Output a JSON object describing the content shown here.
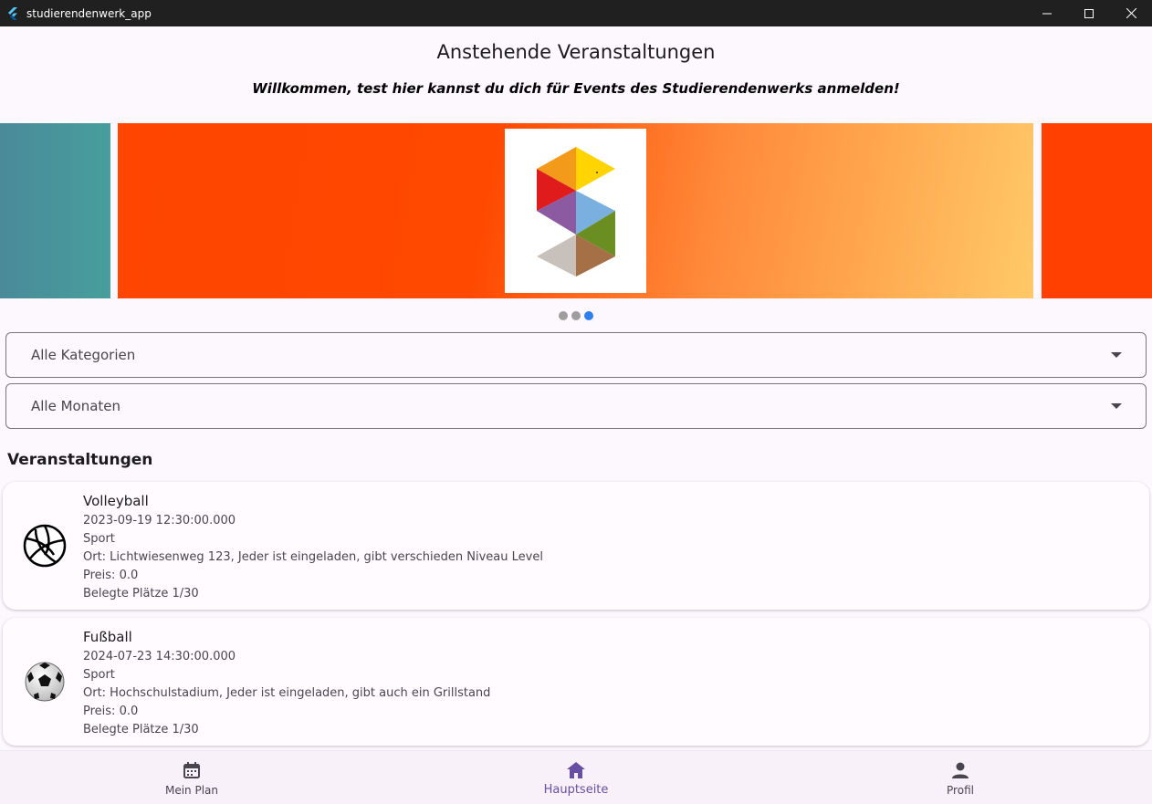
{
  "window": {
    "title": "studierendenwerk_app",
    "controls": [
      "minimize-icon",
      "maximize-icon",
      "close-icon"
    ]
  },
  "header": {
    "title": "Anstehende Veranstaltungen",
    "welcome": "Willkommen, test hier kannst du dich für Events des Studierendenwerks anmelden!"
  },
  "carousel": {
    "slide_count": 3,
    "active_index": 2
  },
  "filters": {
    "category": "Alle Kategorien",
    "month": "Alle Monaten"
  },
  "events_heading": "Veranstaltungen",
  "events": [
    {
      "name": "Volleyball",
      "datetime": "2023-09-19 12:30:00.000",
      "category": "Sport",
      "location": "Ort: Lichtwiesenweg 123, Jeder ist eingeladen, gibt verschieden Niveau Level",
      "price": "Preis: 0.0",
      "seats": "Belegte Plätze 1/30",
      "icon": "volleyball-icon"
    },
    {
      "name": "Fußball",
      "datetime": "2024-07-23 14:30:00.000",
      "category": "Sport",
      "location": "Ort: Hochschulstadium, Jeder ist eingeladen, gibt auch ein Grillstand",
      "price": "Preis: 0.0",
      "seats": "Belegte Plätze 1/30",
      "icon": "soccer-ball-icon"
    }
  ],
  "nav": {
    "items": [
      {
        "label": "Mein Plan",
        "icon": "calendar-icon"
      },
      {
        "label": "Hauptseite",
        "icon": "home-icon"
      },
      {
        "label": "Profil",
        "icon": "person-icon"
      }
    ],
    "active": "Hauptseite"
  },
  "colors": {
    "accent": "#6750a4",
    "dot_active": "#2f80ed",
    "banner_orange": "#ff4500",
    "banner_teal": "#479e9c"
  }
}
